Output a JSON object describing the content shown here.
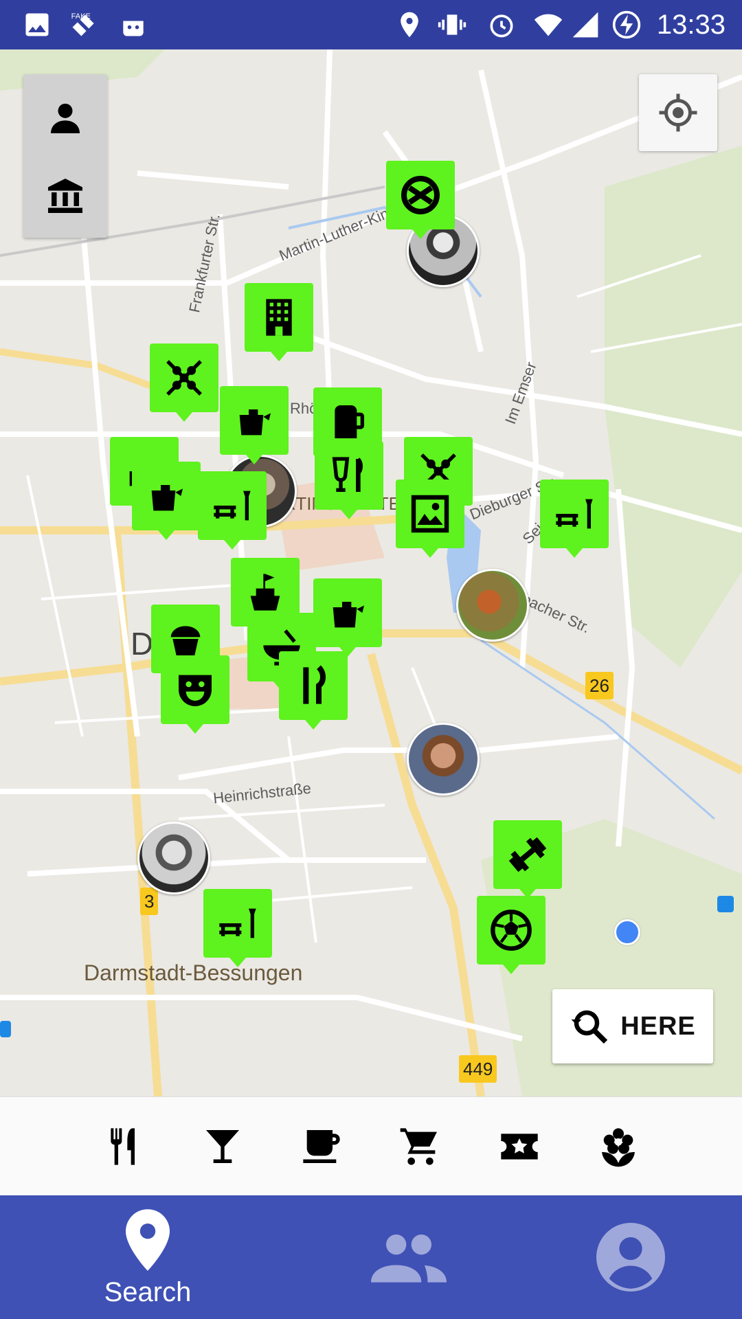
{
  "status_bar": {
    "time": "13:33",
    "left_icons": [
      "image-icon",
      "fake-gps-icon",
      "android-robot-icon"
    ],
    "right_icons": [
      "location-icon",
      "vibrate-icon",
      "alarm-icon",
      "wifi-icon",
      "signal-icon",
      "battery-charging-icon"
    ]
  },
  "map": {
    "street_labels": [
      "Martin-Luther-King-R",
      "Frankfurter Str.",
      "Rhönr",
      "Im Emser",
      "Dieburger Str.",
      "Sei",
      "bacher Str.",
      "Heinrichstraße"
    ],
    "district_labels": [
      "RTINSVIERTE",
      "D",
      "Darmstadt-Bessungen"
    ],
    "road_shields": [
      "26",
      "3",
      "449"
    ],
    "poi_markers": [
      "pretzel-icon",
      "hotel-building-icon",
      "cross-skewers-icon",
      "teapot-icon",
      "beer-mug-icon",
      "glass-cutlery-icon",
      "cross-skewers-icon",
      "cake-icon",
      "teapot-icon",
      "park-bench-icon",
      "gallery-image-icon",
      "park-bench-icon",
      "castle-icon",
      "teapot-icon",
      "muffin-icon",
      "bowl-icon",
      "knife-fork-icon",
      "theater-masks-icon",
      "dumbbell-icon",
      "soccer-ball-icon",
      "park-bench-icon"
    ],
    "avatars": [
      "person-avatar",
      "portrait-avatar",
      "fox-avatar",
      "bearded-man-avatar",
      "scientist-avatar"
    ]
  },
  "left_toolbar": {
    "buttons": [
      "person-icon",
      "museum-icon"
    ]
  },
  "here_button": {
    "label": "HERE",
    "icon": "search-refresh-icon"
  },
  "categories": [
    "restaurant-icon",
    "bar-cocktail-icon",
    "coffee-cup-icon",
    "shopping-cart-icon",
    "ticket-star-icon",
    "flower-icon"
  ],
  "bottom_nav": {
    "items": [
      {
        "label": "Search",
        "icon": "map-pin-icon",
        "active": true
      },
      {
        "label": "",
        "icon": "people-icon",
        "active": false
      },
      {
        "label": "",
        "icon": "account-circle-icon",
        "active": false
      }
    ]
  },
  "colors": {
    "primary": "#3f51b5",
    "status_bar": "#303f9f",
    "poi_green": "#5ef21e",
    "location_blue": "#4285f4"
  }
}
